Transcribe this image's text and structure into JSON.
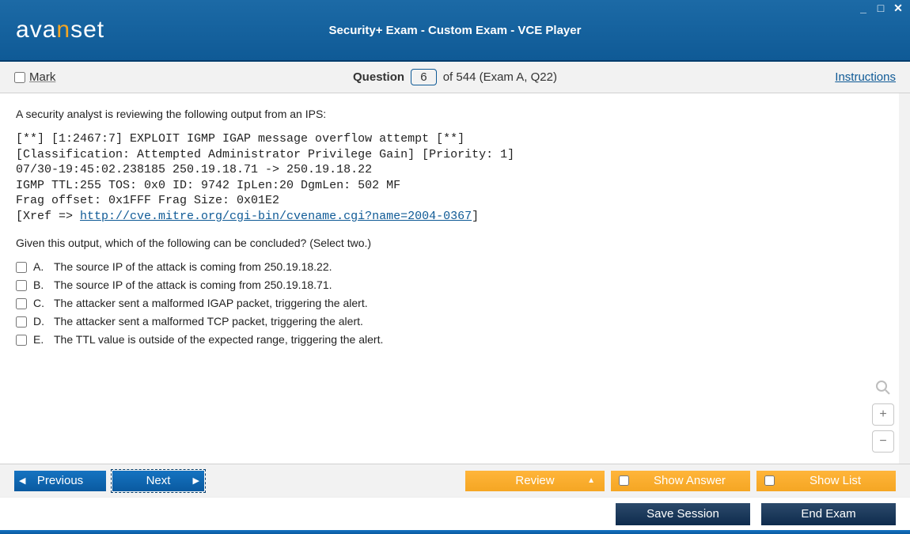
{
  "titlebar": {
    "logo_prefix": "a",
    "logo_v": "v",
    "logo_mid1": "a",
    "logo_n": "n",
    "logo_suffix": "set",
    "title": "Security+ Exam - Custom Exam - VCE Player",
    "minimize": "_",
    "maximize": "□",
    "close": "✕"
  },
  "infobar": {
    "mark_label": "Mark",
    "question_word": "Question",
    "question_number": "6",
    "of_text": "of 544 (Exam A, Q22)",
    "instructions": "Instructions"
  },
  "question": {
    "intro": "A security analyst is reviewing the following output from an IPS:",
    "code_lines": [
      "[**] [1:2467:7] EXPLOIT IGMP IGAP message overflow attempt [**]",
      "[Classification: Attempted Administrator Privilege Gain] [Priority: 1]",
      "07/30-19:45:02.238185 250.19.18.71 -> 250.19.18.22",
      "IGMP TTL:255 TOS: 0x0 ID: 9742 IpLen:20 DgmLen: 502 MF",
      "Frag offset: 0x1FFF Frag Size: 0x01E2"
    ],
    "xref_prefix": "[Xref => ",
    "xref_link": "http://cve.mitre.org/cgi-bin/cvename.cgi?name=2004-0367",
    "xref_suffix": "]",
    "subq": "Given this output, which of the following can be concluded? (Select two.)",
    "options": [
      {
        "letter": "A.",
        "text": "The source IP of the attack is coming from 250.19.18.22."
      },
      {
        "letter": "B.",
        "text": "The source IP of the attack is coming from 250.19.18.71."
      },
      {
        "letter": "C.",
        "text": "The attacker sent a malformed IGAP packet, triggering the alert."
      },
      {
        "letter": "D.",
        "text": "The attacker sent a malformed TCP packet, triggering the alert."
      },
      {
        "letter": "E.",
        "text": "The TTL value is outside of the expected range, triggering the alert."
      }
    ]
  },
  "zoom": {
    "magnify": "🔍",
    "plus": "+",
    "minus": "−"
  },
  "btnbar1": {
    "previous": "Previous",
    "next": "Next",
    "review": "Review",
    "show_answer": "Show Answer",
    "show_list": "Show List"
  },
  "btnbar2": {
    "save_session": "Save Session",
    "end_exam": "End Exam"
  }
}
